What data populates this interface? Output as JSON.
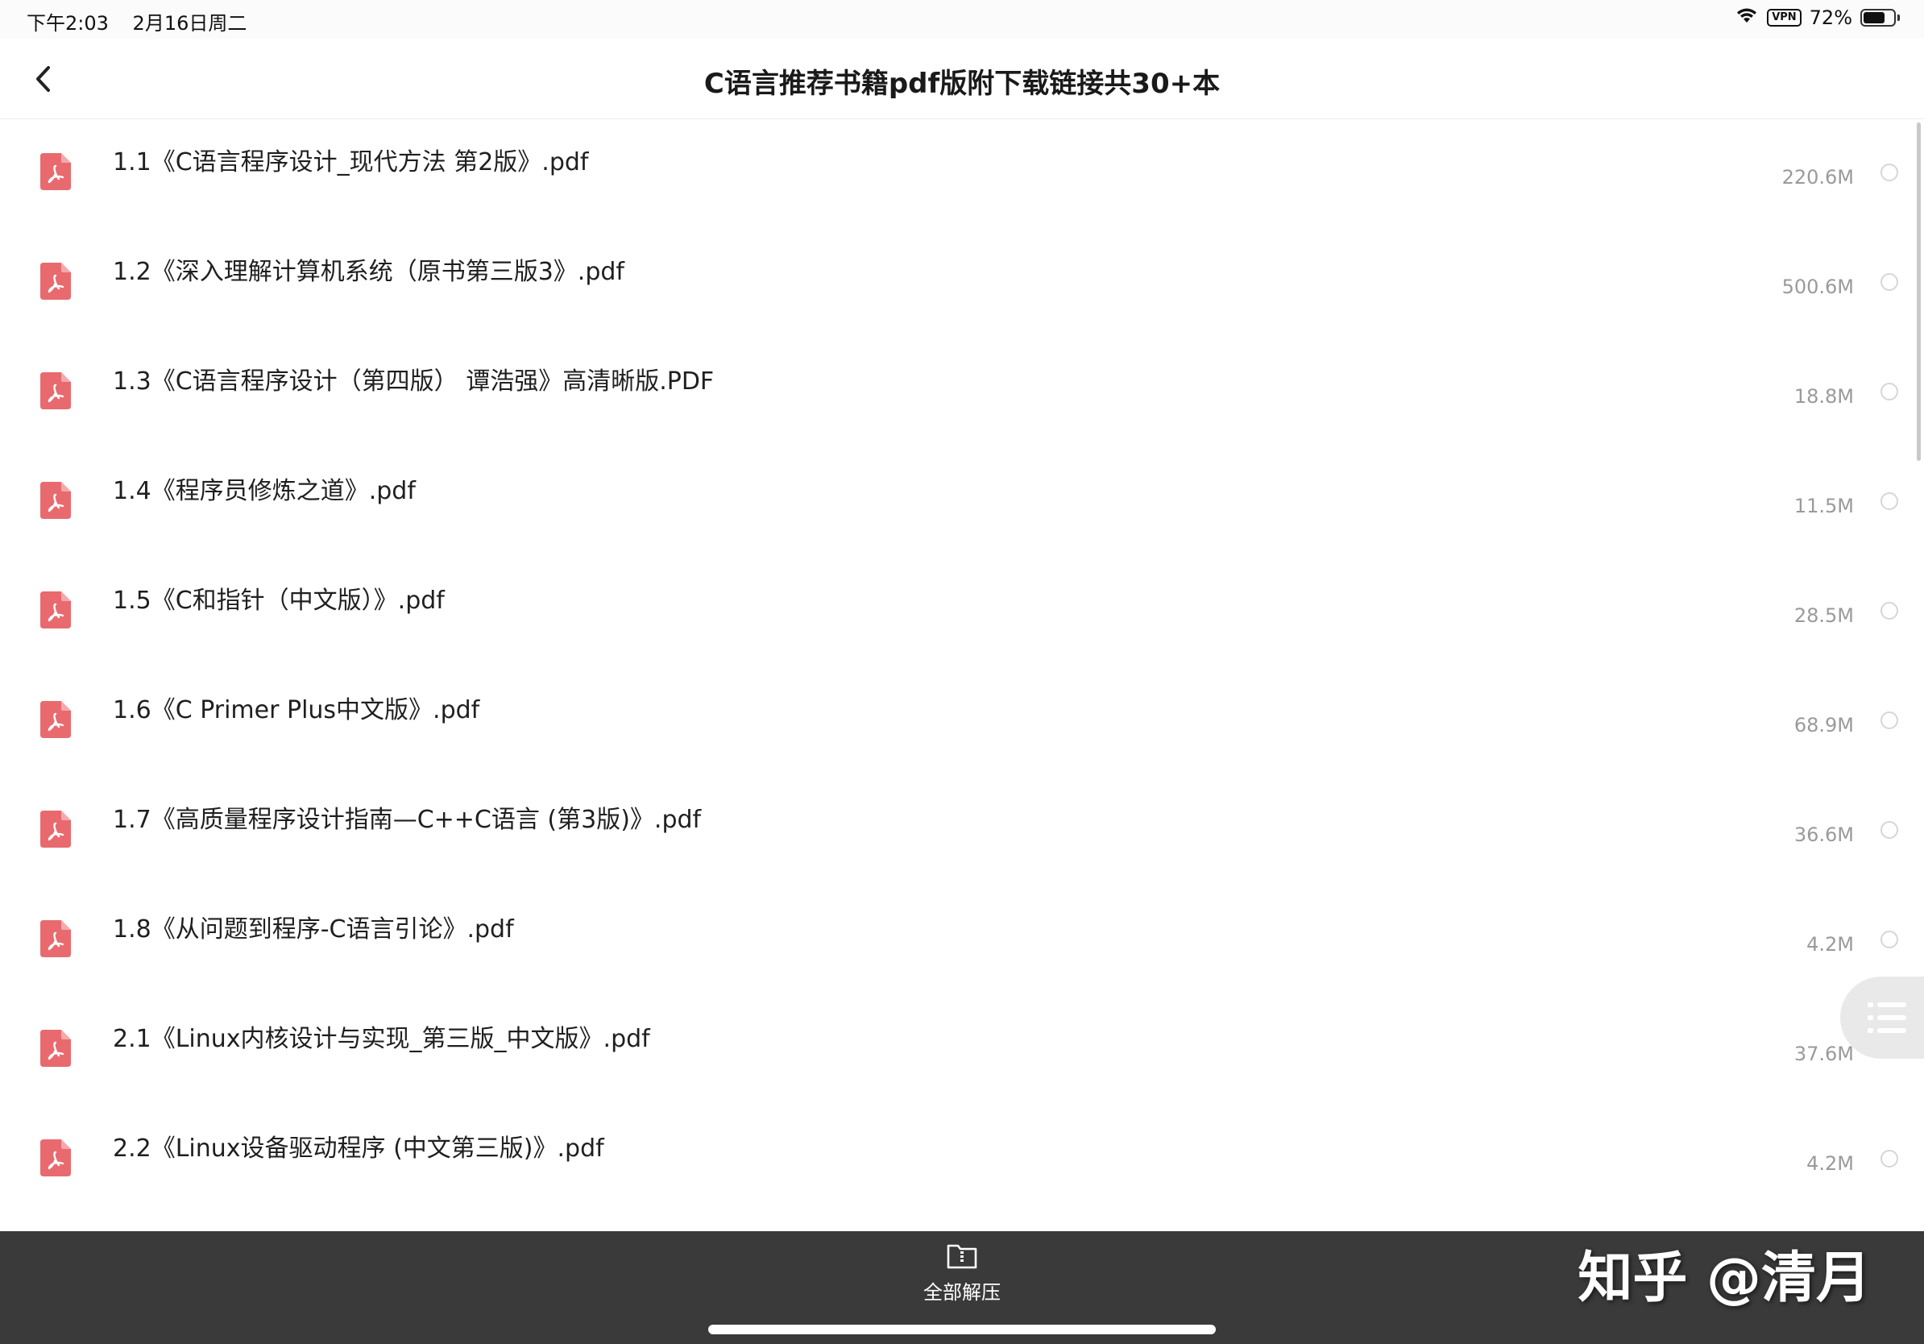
{
  "status_bar": {
    "time": "下午2:03",
    "date": "2月16日周二",
    "vpn": "VPN",
    "battery": "72%",
    "battery_level": 0.72
  },
  "nav": {
    "title": "C语言推荐书籍pdf版附下载链接共30+本"
  },
  "files": [
    {
      "name": "1.1《C语言程序设计_现代方法 第2版》.pdf",
      "size": "220.6M"
    },
    {
      "name": "1.2《深入理解计算机系统（原书第三版3》.pdf",
      "size": "500.6M"
    },
    {
      "name": "1.3《C语言程序设计（第四版） 谭浩强》高清晰版.PDF",
      "size": "18.8M"
    },
    {
      "name": "1.4《程序员修炼之道》.pdf",
      "size": "11.5M"
    },
    {
      "name": "1.5《C和指针（中文版）》.pdf",
      "size": "28.5M"
    },
    {
      "name": "1.6《C Primer Plus中文版》.pdf",
      "size": "68.9M"
    },
    {
      "name": "1.7《高质量程序设计指南—C++C语言 (第3版)》.pdf",
      "size": "36.6M"
    },
    {
      "name": "1.8《从问题到程序-C语言引论》.pdf",
      "size": "4.2M"
    },
    {
      "name": "2.1《Linux内核设计与实现_第三版_中文版》.pdf",
      "size": "37.6M"
    },
    {
      "name": "2.2《Linux设备驱动程序 (中文第三版)》.pdf",
      "size": "4.2M"
    }
  ],
  "bottom_bar": {
    "extract_all_label": "全部解压",
    "watermark": "知乎 @清月"
  },
  "colors": {
    "pdf_icon": "#e86a6f",
    "bottom_bar": "#3a3a3a",
    "file_size": "#9a9a9a"
  }
}
